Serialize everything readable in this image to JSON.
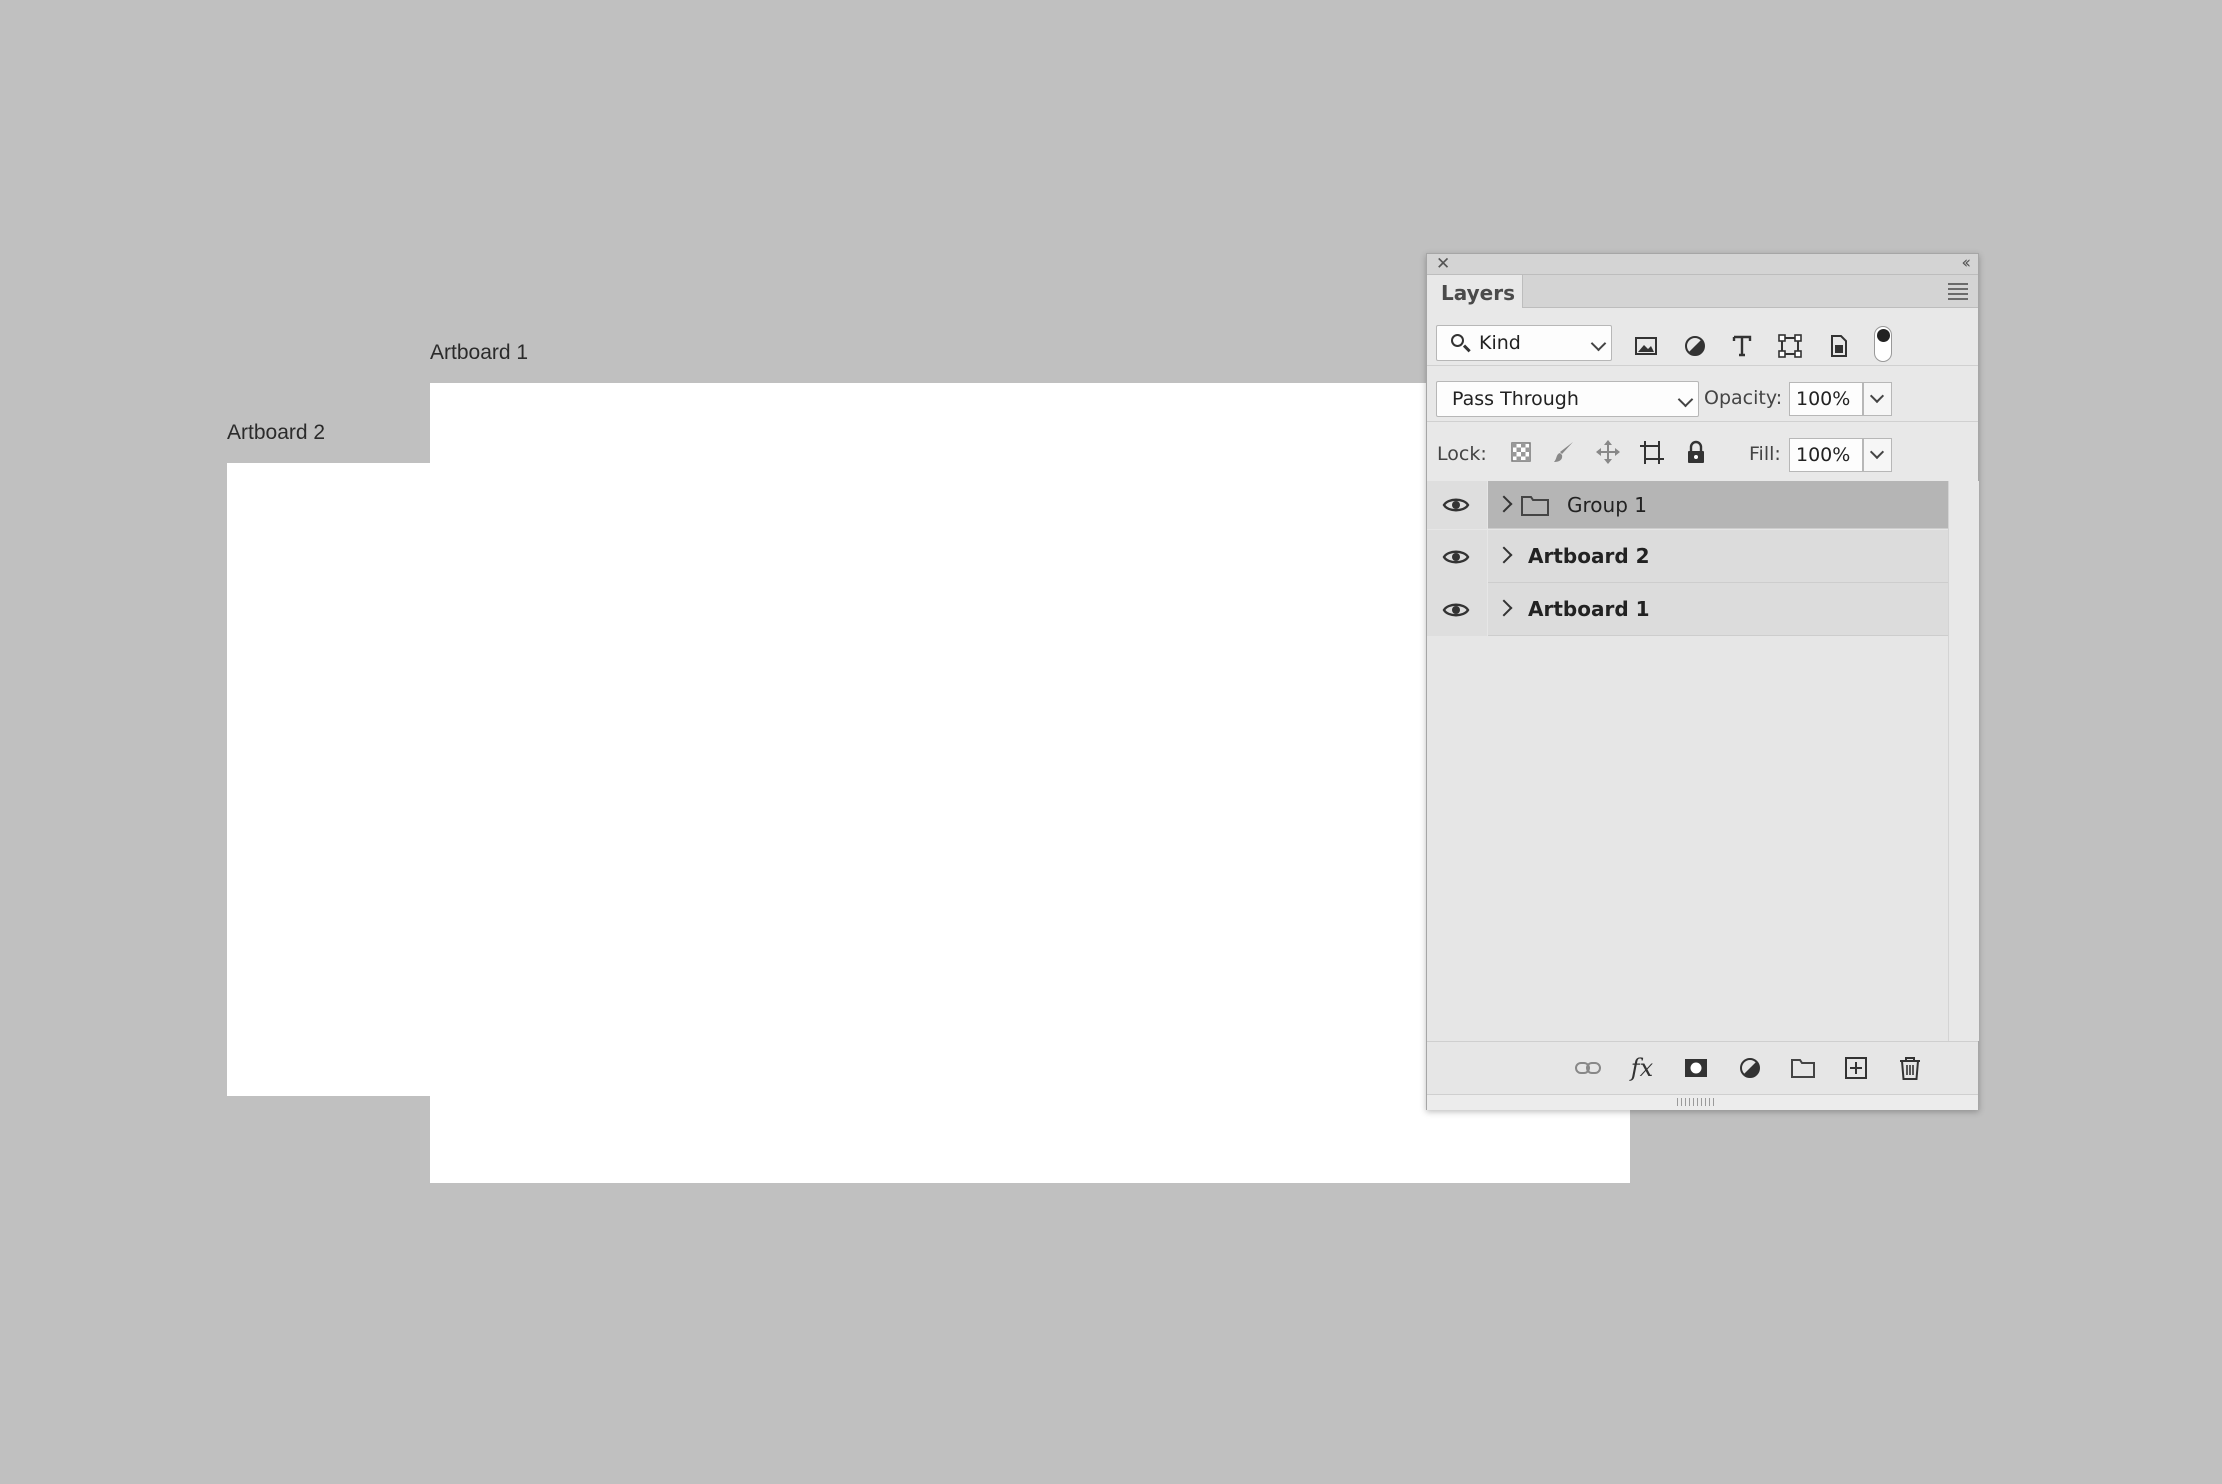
{
  "canvas": {
    "background": "#c0c0c0",
    "artboards": [
      {
        "label": "Artboard 2"
      },
      {
        "label": "Artboard 1"
      }
    ]
  },
  "panel": {
    "tab_label": "Layers",
    "filter": {
      "kind_label": "Kind",
      "icons": [
        "image-filter-icon",
        "adjustment-filter-icon",
        "type-filter-icon",
        "shape-filter-icon",
        "smart-object-filter-icon"
      ],
      "toggle_state": "on"
    },
    "blend": {
      "mode": "Pass Through",
      "opacity_label": "Opacity:",
      "opacity_value": "100%"
    },
    "lock": {
      "label": "Lock:",
      "icons": [
        "lock-transparent-pixels-icon",
        "lock-image-pixels-icon",
        "lock-position-icon",
        "lock-artboard-icon",
        "lock-all-icon"
      ],
      "fill_label": "Fill:",
      "fill_value": "100%"
    },
    "layers": [
      {
        "name": "Group 1",
        "type": "group",
        "selected": true,
        "visible": true
      },
      {
        "name": "Artboard 2",
        "type": "artboard",
        "selected": false,
        "visible": true
      },
      {
        "name": "Artboard 1",
        "type": "artboard",
        "selected": false,
        "visible": true
      }
    ],
    "footer_icons": [
      "link-layers-icon",
      "fx-icon",
      "add-mask-icon",
      "new-adjustment-icon",
      "new-group-icon",
      "new-layer-icon",
      "delete-icon"
    ]
  }
}
